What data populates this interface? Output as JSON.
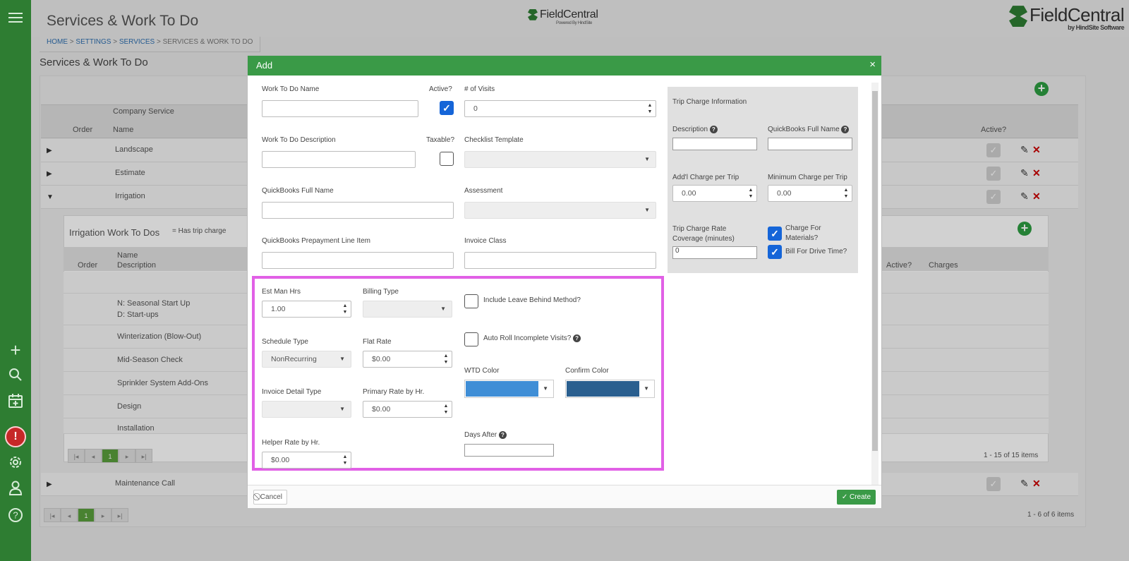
{
  "header": {
    "page_title": "Services & Work To Do",
    "logo_center": "FieldCentral",
    "logo_center_sub": "Powered By HindSite",
    "logo_right": "FieldCentral",
    "logo_right_sub": "by HindSite Software"
  },
  "breadcrumb": {
    "home": "HOME",
    "settings": "SETTINGS",
    "services": "SERVICES",
    "current": "SERVICES & WORK TO DO",
    "sep": ">"
  },
  "section_title": "Services & Work To Do",
  "services_grid": {
    "group_header": "Company Service",
    "col_order": "Order",
    "col_name": "Name",
    "col_active": "Active?",
    "rows": [
      "Landscape",
      "Estimate",
      "Irrigation"
    ],
    "last_row": "Maintenance Call",
    "pager_current": "1",
    "items_count": "1 - 6 of 6 items"
  },
  "irrigation_panel": {
    "title": "Irrigation Work To Dos",
    "legend": "= Has trip charge",
    "col_order": "Order",
    "col_name": "Name",
    "col_description": "Description",
    "col_active": "Active?",
    "col_charges": "Charges",
    "rows": [
      {
        "line1": "",
        "line2": ""
      },
      {
        "line1": "N: Seasonal Start Up",
        "line2": "D: Start-ups"
      },
      {
        "line1": "Winterization (Blow-Out)",
        "line2": ""
      },
      {
        "line1": "Mid-Season Check",
        "line2": ""
      },
      {
        "line1": "Sprinkler System Add-Ons",
        "line2": ""
      },
      {
        "line1": "Design",
        "line2": ""
      },
      {
        "line1": "Installation",
        "line2": ""
      }
    ],
    "pager_current": "1",
    "items_count": "1 - 15 of 15 items"
  },
  "modal": {
    "title": "Add",
    "close": "×",
    "fields": {
      "work_to_do_name": {
        "label": "Work To Do Name",
        "value": ""
      },
      "active": {
        "label": "Active?",
        "checked": true
      },
      "num_visits": {
        "label": "# of Visits",
        "value": "0"
      },
      "work_to_do_description": {
        "label": "Work To Do Description",
        "value": ""
      },
      "taxable": {
        "label": "Taxable?",
        "checked": false
      },
      "checklist_template": {
        "label": "Checklist Template",
        "value": ""
      },
      "quickbooks_full_name": {
        "label": "QuickBooks Full Name",
        "value": ""
      },
      "assessment": {
        "label": "Assessment",
        "value": ""
      },
      "quickbooks_prepayment": {
        "label": "QuickBooks Prepayment Line Item",
        "value": ""
      },
      "invoice_class": {
        "label": "Invoice Class",
        "value": ""
      },
      "est_man_hrs": {
        "label": "Est Man Hrs",
        "value": "1.00"
      },
      "billing_type": {
        "label": "Billing Type",
        "value": ""
      },
      "include_leave_behind": {
        "label": "Include Leave Behind Method?",
        "checked": false
      },
      "schedule_type": {
        "label": "Schedule Type",
        "value": "NonRecurring"
      },
      "flat_rate": {
        "label": "Flat Rate",
        "value": "$0.00"
      },
      "auto_roll": {
        "label": "Auto Roll Incomplete Visits?",
        "checked": false
      },
      "invoice_detail_type": {
        "label": "Invoice Detail Type",
        "value": ""
      },
      "primary_rate": {
        "label": "Primary Rate by Hr.",
        "value": "$0.00"
      },
      "wtd_color": {
        "label": "WTD Color",
        "color": "#3f8ed6"
      },
      "confirm_color": {
        "label": "Confirm Color",
        "color": "#2a5f8f"
      },
      "helper_rate": {
        "label": "Helper Rate by Hr.",
        "value": "$0.00"
      },
      "days_after": {
        "label": "Days After",
        "value": ""
      }
    },
    "trip_charge": {
      "title": "Trip Charge Information",
      "description_label": "Description",
      "description_value": "",
      "qb_full_name_label": "QuickBooks Full Name",
      "qb_full_name_value": "",
      "addl_charge_label": "Add'l Charge per Trip",
      "addl_charge_value": "0.00",
      "min_charge_label": "Minimum Charge per Trip",
      "min_charge_value": "0.00",
      "rate_coverage_label_1": "Trip Charge Rate",
      "rate_coverage_label_2": "Coverage (minutes)",
      "rate_coverage_value": "0",
      "charge_materials_label_1": "Charge For",
      "charge_materials_label_2": "Materials?",
      "charge_materials_checked": true,
      "bill_drive_time_label": "Bill For Drive Time?",
      "bill_drive_time_checked": true
    },
    "footer": {
      "cancel": "Cancel",
      "create": "Create"
    }
  },
  "colors": {
    "sidebar": "#2e7d32",
    "header_green": "#3a9a47",
    "highlight": "#e160e6",
    "checkbox_blue": "#1565d8"
  }
}
